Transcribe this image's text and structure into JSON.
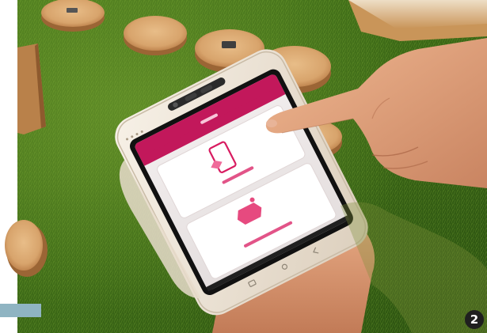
{
  "figure": {
    "number_badge": "2"
  },
  "colors": {
    "grass_dark": "#2f5a14",
    "grass_light": "#6c9a2a",
    "wood": "#d9a56f",
    "terminal_shell": "#efe6d9",
    "screen_accent": "#c2185b",
    "skin": "#e2a47f",
    "side_bar": "#8fb4c2"
  }
}
